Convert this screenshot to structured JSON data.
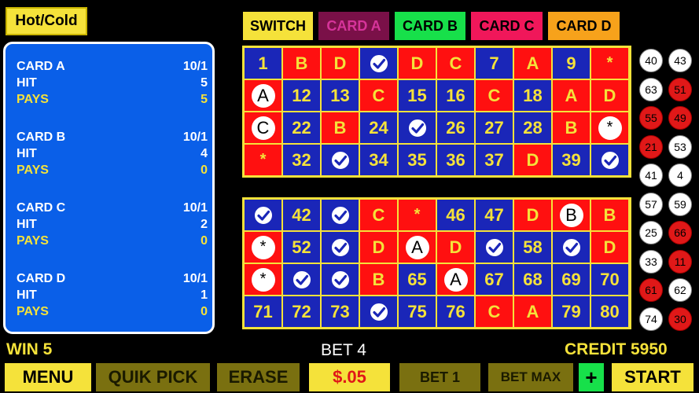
{
  "top": {
    "hotcold": "Hot/Cold",
    "cards": [
      "SWITCH",
      "CARD A",
      "CARD B",
      "CARD C",
      "CARD D"
    ]
  },
  "panel": [
    {
      "card": "CARD A",
      "odds": "10/1",
      "hit_label": "HIT",
      "hit": "5",
      "pays_label": "PAYS",
      "pays": "5"
    },
    {
      "card": "CARD B",
      "odds": "10/1",
      "hit_label": "HIT",
      "hit": "4",
      "pays_label": "PAYS",
      "pays": "0"
    },
    {
      "card": "CARD C",
      "odds": "10/1",
      "hit_label": "HIT",
      "hit": "2",
      "pays_label": "PAYS",
      "pays": "0"
    },
    {
      "card": "CARD D",
      "odds": "10/1",
      "hit_label": "HIT",
      "hit": "1",
      "pays_label": "PAYS",
      "pays": "0"
    }
  ],
  "grid_top": [
    {
      "t": "1",
      "c": "blue"
    },
    {
      "t": "B",
      "c": "red"
    },
    {
      "t": "D",
      "c": "red"
    },
    {
      "t": "check",
      "c": "blue"
    },
    {
      "t": "D",
      "c": "red"
    },
    {
      "t": "C",
      "c": "red"
    },
    {
      "t": "7",
      "c": "blue"
    },
    {
      "t": "A",
      "c": "red"
    },
    {
      "t": "9",
      "c": "blue"
    },
    {
      "t": "*",
      "c": "red"
    },
    {
      "t": "A",
      "c": "red",
      "mark": "letter"
    },
    {
      "t": "12",
      "c": "blue"
    },
    {
      "t": "13",
      "c": "blue"
    },
    {
      "t": "C",
      "c": "red"
    },
    {
      "t": "15",
      "c": "blue"
    },
    {
      "t": "16",
      "c": "blue"
    },
    {
      "t": "C",
      "c": "red"
    },
    {
      "t": "18",
      "c": "blue"
    },
    {
      "t": "A",
      "c": "red"
    },
    {
      "t": "D",
      "c": "red"
    },
    {
      "t": "C",
      "c": "red",
      "mark": "letter"
    },
    {
      "t": "22",
      "c": "blue"
    },
    {
      "t": "B",
      "c": "red"
    },
    {
      "t": "24",
      "c": "blue"
    },
    {
      "t": "check",
      "c": "blue"
    },
    {
      "t": "26",
      "c": "blue"
    },
    {
      "t": "27",
      "c": "blue"
    },
    {
      "t": "28",
      "c": "blue"
    },
    {
      "t": "B",
      "c": "red"
    },
    {
      "t": "*",
      "c": "red",
      "mark": "star"
    },
    {
      "t": "*",
      "c": "red"
    },
    {
      "t": "32",
      "c": "blue"
    },
    {
      "t": "check",
      "c": "blue"
    },
    {
      "t": "34",
      "c": "blue"
    },
    {
      "t": "35",
      "c": "blue"
    },
    {
      "t": "36",
      "c": "blue"
    },
    {
      "t": "37",
      "c": "blue"
    },
    {
      "t": "D",
      "c": "red"
    },
    {
      "t": "39",
      "c": "blue"
    },
    {
      "t": "check",
      "c": "blue"
    }
  ],
  "grid_bot": [
    {
      "t": "check",
      "c": "blue"
    },
    {
      "t": "42",
      "c": "blue"
    },
    {
      "t": "check",
      "c": "blue"
    },
    {
      "t": "C",
      "c": "red"
    },
    {
      "t": "*",
      "c": "red"
    },
    {
      "t": "46",
      "c": "blue"
    },
    {
      "t": "47",
      "c": "blue"
    },
    {
      "t": "D",
      "c": "red"
    },
    {
      "t": "B",
      "c": "red",
      "mark": "letter"
    },
    {
      "t": "B",
      "c": "red"
    },
    {
      "t": "*",
      "c": "red",
      "mark": "star"
    },
    {
      "t": "52",
      "c": "blue"
    },
    {
      "t": "check",
      "c": "blue"
    },
    {
      "t": "D",
      "c": "red"
    },
    {
      "t": "A",
      "c": "red",
      "mark": "letter"
    },
    {
      "t": "D",
      "c": "red"
    },
    {
      "t": "check",
      "c": "blue"
    },
    {
      "t": "58",
      "c": "blue"
    },
    {
      "t": "check",
      "c": "blue"
    },
    {
      "t": "D",
      "c": "red"
    },
    {
      "t": "*",
      "c": "red",
      "mark": "star"
    },
    {
      "t": "check",
      "c": "blue"
    },
    {
      "t": "check",
      "c": "blue"
    },
    {
      "t": "B",
      "c": "red"
    },
    {
      "t": "65",
      "c": "blue"
    },
    {
      "t": "A",
      "c": "red",
      "mark": "letter"
    },
    {
      "t": "67",
      "c": "blue"
    },
    {
      "t": "68",
      "c": "blue"
    },
    {
      "t": "69",
      "c": "blue"
    },
    {
      "t": "70",
      "c": "blue"
    },
    {
      "t": "71",
      "c": "blue"
    },
    {
      "t": "72",
      "c": "blue"
    },
    {
      "t": "73",
      "c": "blue"
    },
    {
      "t": "check",
      "c": "blue"
    },
    {
      "t": "75",
      "c": "blue"
    },
    {
      "t": "76",
      "c": "blue"
    },
    {
      "t": "C",
      "c": "red"
    },
    {
      "t": "A",
      "c": "red"
    },
    {
      "t": "79",
      "c": "blue"
    },
    {
      "t": "80",
      "c": "blue"
    }
  ],
  "balls": [
    {
      "n": "40",
      "c": "white"
    },
    {
      "n": "43",
      "c": "white"
    },
    {
      "n": "63",
      "c": "white"
    },
    {
      "n": "51",
      "c": "red"
    },
    {
      "n": "55",
      "c": "red"
    },
    {
      "n": "49",
      "c": "red"
    },
    {
      "n": "21",
      "c": "red"
    },
    {
      "n": "53",
      "c": "white"
    },
    {
      "n": "41",
      "c": "white"
    },
    {
      "n": "4",
      "c": "white"
    },
    {
      "n": "57",
      "c": "white"
    },
    {
      "n": "59",
      "c": "white"
    },
    {
      "n": "25",
      "c": "white"
    },
    {
      "n": "66",
      "c": "red"
    },
    {
      "n": "33",
      "c": "white"
    },
    {
      "n": "11",
      "c": "red"
    },
    {
      "n": "61",
      "c": "red"
    },
    {
      "n": "62",
      "c": "white"
    },
    {
      "n": "74",
      "c": "white"
    },
    {
      "n": "30",
      "c": "red"
    }
  ],
  "status": {
    "win": "WIN 5",
    "bet": "BET 4",
    "credit": "CREDIT 5950"
  },
  "bottom": {
    "menu": "MENU",
    "quik_pick": "QUIK PICK",
    "erase": "ERASE",
    "denom": "$.05",
    "bet1": "BET 1",
    "bet_max": "BET MAX",
    "plus": "+",
    "start": "START"
  },
  "colors": {
    "yellow": "#f5e23a",
    "blue": "#1a26b8",
    "red": "#ff1010",
    "panel": "#0a5fe8"
  }
}
